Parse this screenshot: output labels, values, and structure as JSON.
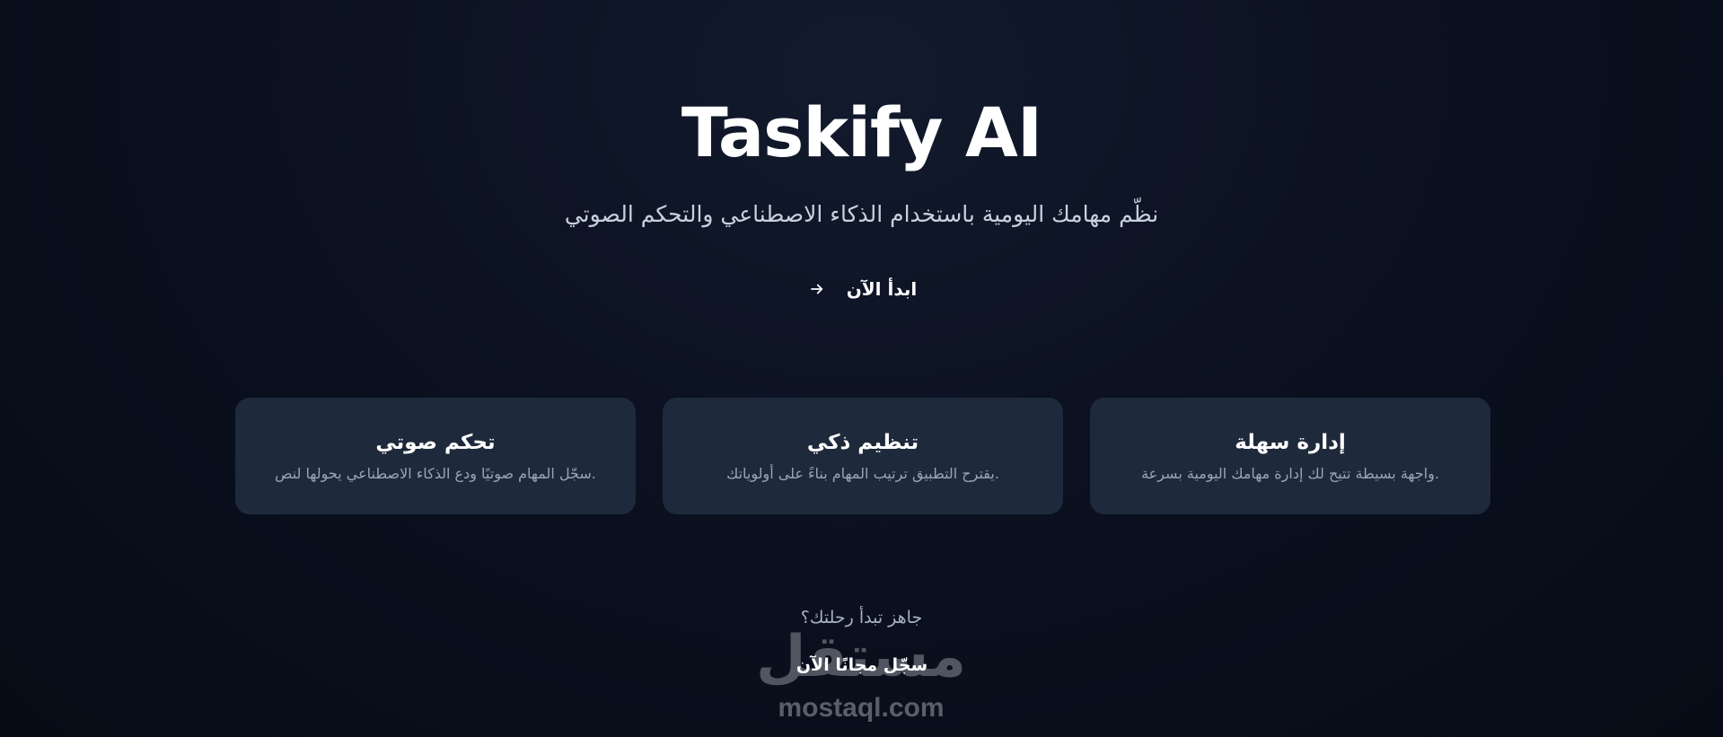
{
  "hero": {
    "title": "Taskify AI",
    "subtitle": "نظّم مهامك اليومية باستخدام الذكاء الاصطناعي والتحكم الصوتي",
    "cta_label": "ابدأ الآن",
    "cta_icon": "arrow-right-icon"
  },
  "features": [
    {
      "title": "إدارة سهلة",
      "description": ".واجهة بسيطة تتيح لك إدارة مهامك اليومية بسرعة"
    },
    {
      "title": "تنظيم ذكي",
      "description": ".يقترح التطبيق ترتيب المهام بناءً على أولوياتك"
    },
    {
      "title": "تحكم صوتي",
      "description": ".سجّل المهام صوتيًا ودع الذكاء الاصطناعي يحولها لنص"
    }
  ],
  "footer": {
    "question": "جاهز تبدأ رحلتك؟",
    "signup_label": "سجّل مجانًا الآن"
  },
  "watermark": {
    "mark": "مستقل",
    "text": "mostaql.com"
  },
  "colors": {
    "background": "#0b1120",
    "card": "#1e2a3b",
    "muted_text": "#9aa5b7"
  }
}
